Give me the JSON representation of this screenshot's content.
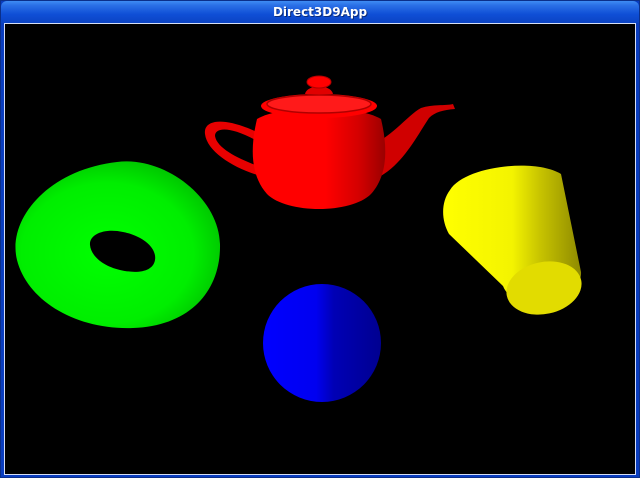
{
  "window": {
    "title": "Direct3D9App"
  },
  "scene": {
    "background_color": "#000000",
    "objects": [
      {
        "name": "teapot",
        "color": "#ff0000"
      },
      {
        "name": "torus",
        "color": "#00ff00"
      },
      {
        "name": "cylinder",
        "color": "#ffff00"
      },
      {
        "name": "sphere",
        "color": "#0000ff"
      }
    ]
  }
}
